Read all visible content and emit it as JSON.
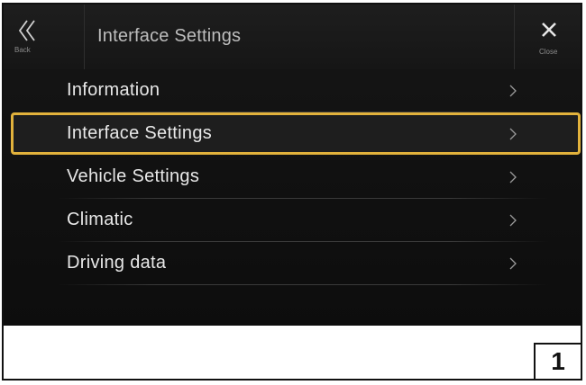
{
  "header": {
    "title": "Interface Settings",
    "back_label": "Back",
    "close_label": "Close"
  },
  "menu": {
    "items": [
      {
        "label": "Information",
        "selected": false
      },
      {
        "label": "Interface Settings",
        "selected": true
      },
      {
        "label": "Vehicle Settings",
        "selected": false
      },
      {
        "label": "Climatic",
        "selected": false
      },
      {
        "label": "Driving data",
        "selected": false
      }
    ]
  },
  "figure_number": "1",
  "colors": {
    "highlight": "#e2b23c",
    "background": "#121212",
    "text": "#e8e8e8"
  },
  "icons": {
    "back": "double-chevron-left-icon",
    "close": "close-icon",
    "row_arrow": "chevron-right-icon"
  }
}
